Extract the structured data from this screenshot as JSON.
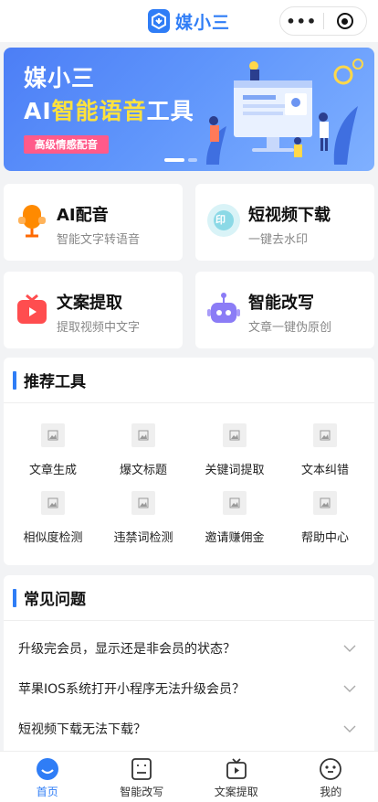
{
  "header": {
    "logo_text": "媒小三",
    "menu_dots": "•••"
  },
  "banner": {
    "brand": "媒小三",
    "title_prefix": "AI",
    "title_highlight": "智能语音",
    "title_suffix": "工具",
    "tag": "高级情感配音"
  },
  "features": [
    {
      "title": "AI配音",
      "subtitle": "智能文字转语音",
      "icon": "microphone-icon"
    },
    {
      "title": "短视频下载",
      "subtitle": "一键去水印",
      "icon": "watermark-icon",
      "badge": "印"
    },
    {
      "title": "文案提取",
      "subtitle": "提取视频中文字",
      "icon": "tv-icon"
    },
    {
      "title": "智能改写",
      "subtitle": "文章一键伪原创",
      "icon": "robot-icon"
    }
  ],
  "tools_section": {
    "title": "推荐工具",
    "items": [
      {
        "label": "文章生成",
        "icon": "image-placeholder-icon"
      },
      {
        "label": "爆文标题",
        "icon": "image-placeholder-icon"
      },
      {
        "label": "关键词提取",
        "icon": "image-placeholder-icon"
      },
      {
        "label": "文本纠错",
        "icon": "image-placeholder-icon"
      },
      {
        "label": "相似度检测",
        "icon": "image-placeholder-icon"
      },
      {
        "label": "违禁词检测",
        "icon": "image-placeholder-icon"
      },
      {
        "label": "邀请赚佣金",
        "icon": "image-placeholder-icon"
      },
      {
        "label": "帮助中心",
        "icon": "image-placeholder-icon"
      }
    ]
  },
  "faq_section": {
    "title": "常见问题",
    "items": [
      {
        "question": "升级完会员，显示还是非会员的状态？"
      },
      {
        "question": "苹果IOS系统打开小程序无法升级会员？"
      },
      {
        "question": "短视频下载无法下载？"
      }
    ]
  },
  "tabbar": [
    {
      "label": "首页",
      "icon": "home-icon",
      "active": true
    },
    {
      "label": "智能改写",
      "icon": "document-icon",
      "active": false
    },
    {
      "label": "文案提取",
      "icon": "tv-icon",
      "active": false
    },
    {
      "label": "我的",
      "icon": "profile-face-icon",
      "active": false
    }
  ],
  "colors": {
    "accent": "#2f7df6",
    "banner_highlight": "#ffe23d",
    "tag": "#ff5a8a"
  }
}
